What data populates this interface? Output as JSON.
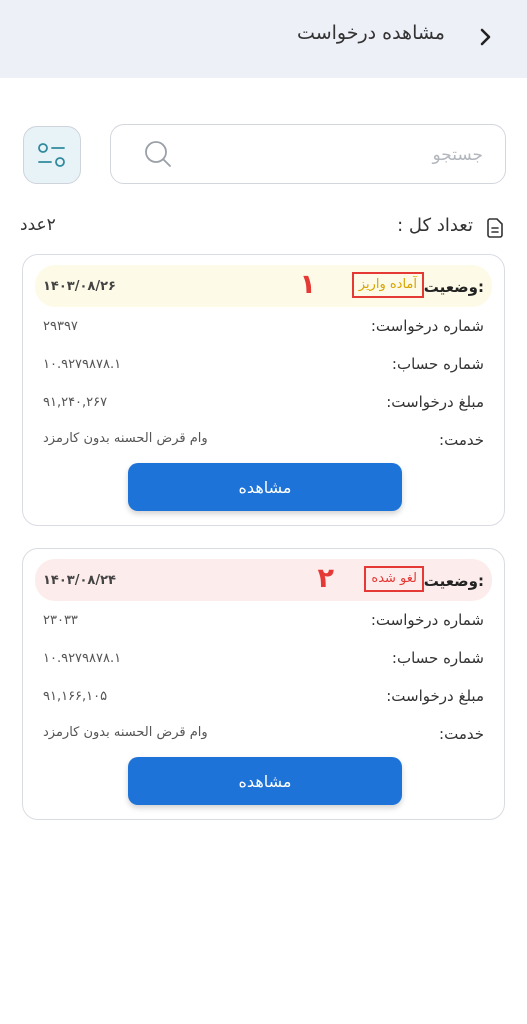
{
  "header": {
    "title": "مشاهده درخواست",
    "back_icon": "chevron-right-icon"
  },
  "search": {
    "placeholder": "جستجو",
    "value": "",
    "icon": "search-icon"
  },
  "filter": {
    "icon": "filter-icon"
  },
  "summary": {
    "label": "تعداد کل :",
    "count": "۲عدد",
    "icon": "document-icon"
  },
  "requests": [
    {
      "status_label": "وضعیت:",
      "status_value": "آماده واریز",
      "status_color": "#d9a400",
      "strip_color": "#fdfbe7",
      "marker": "۱",
      "date": "۱۴۰۳/۰۸/۲۶",
      "fields": [
        {
          "label": "شماره درخواست:",
          "value": "۲۹۳۹۷"
        },
        {
          "label": "شماره حساب:",
          "value": "۱۰.۹۲۷۹۸۷۸.۱"
        },
        {
          "label": "مبلغ درخواست:",
          "value": "۹۱,۲۴۰,۲۶۷"
        },
        {
          "label": "خدمت:",
          "value": "وام قرض الحسنه بدون کارمزد"
        }
      ],
      "button_label": "مشاهده"
    },
    {
      "status_label": "وضعیت:",
      "status_value": "لغو شده",
      "status_color": "#e53935",
      "strip_color": "#fdecec",
      "marker": "۲",
      "date": "۱۴۰۳/۰۸/۲۴",
      "fields": [
        {
          "label": "شماره درخواست:",
          "value": "۲۳۰۳۳"
        },
        {
          "label": "شماره حساب:",
          "value": "۱۰.۹۲۷۹۸۷۸.۱"
        },
        {
          "label": "مبلغ درخواست:",
          "value": "۹۱,۱۶۶,۱۰۵"
        },
        {
          "label": "خدمت:",
          "value": "وام قرض الحسنه بدون کارمزد"
        }
      ],
      "button_label": "مشاهده"
    }
  ],
  "colors": {
    "header_bg": "#eef0f8",
    "primary_button": "#1d73d8",
    "highlight_border": "#e53935"
  }
}
